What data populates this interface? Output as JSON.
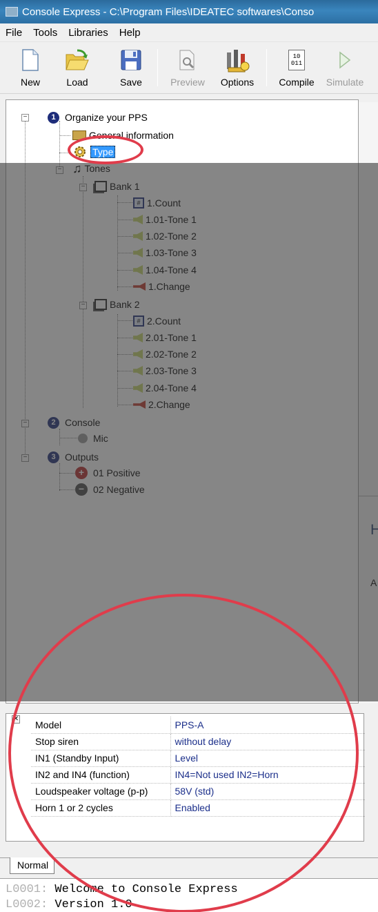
{
  "window": {
    "title": "Console Express - C:\\Program Files\\IDEATEC softwares\\Conso"
  },
  "menu": [
    "File",
    "Tools",
    "Libraries",
    "Help"
  ],
  "toolbar": {
    "new": "New",
    "load": "Load",
    "save": "Save",
    "preview": "Preview",
    "options": "Options",
    "compile": "Compile",
    "simulate": "Simulate",
    "compile_icon_text": "10\n011"
  },
  "tree": {
    "organize": {
      "num": "1",
      "label": "Organize your PPS"
    },
    "general": "General information",
    "type": "Type",
    "tones": "Tones",
    "bank1": "Bank 1",
    "bank1_items": [
      "1.Count",
      "1.01-Tone 1",
      "1.02-Tone 2",
      "1.03-Tone 3",
      "1.04-Tone 4",
      "1.Change"
    ],
    "bank2": "Bank 2",
    "bank2_items": [
      "2.Count",
      "2.01-Tone 1",
      "2.02-Tone 2",
      "2.03-Tone 3",
      "2.04-Tone 4",
      "2.Change"
    ],
    "console": {
      "num": "2",
      "label": "Console"
    },
    "mic": "Mic",
    "outputs": {
      "num": "3",
      "label": "Outputs"
    },
    "positive": "01 Positive",
    "negative": "02 Negative"
  },
  "right_panel": {
    "heading": "H",
    "text": "A"
  },
  "properties": [
    {
      "name": "Model",
      "value": "PPS-A"
    },
    {
      "name": "Stop siren",
      "value": "without delay"
    },
    {
      "name": "IN1 (Standby Input)",
      "value": "Level"
    },
    {
      "name": "IN2 and IN4 (function)",
      "value": "IN4=Not used IN2=Horn"
    },
    {
      "name": "Loudspeaker voltage (p-p)",
      "value": "58V (std)"
    },
    {
      "name": "Horn 1 or 2 cycles",
      "value": "Enabled"
    }
  ],
  "tabs": {
    "normal": "Normal"
  },
  "console_log": {
    "line1_no": "L0001:",
    "line1_text": " Welcome to Console Express",
    "line2_no": "L0002:",
    "line2_text": " Version 1.0"
  },
  "colors": {
    "annotation": "#e03c4b",
    "selection": "#3399ff",
    "titlebar": "#2f78b0"
  }
}
